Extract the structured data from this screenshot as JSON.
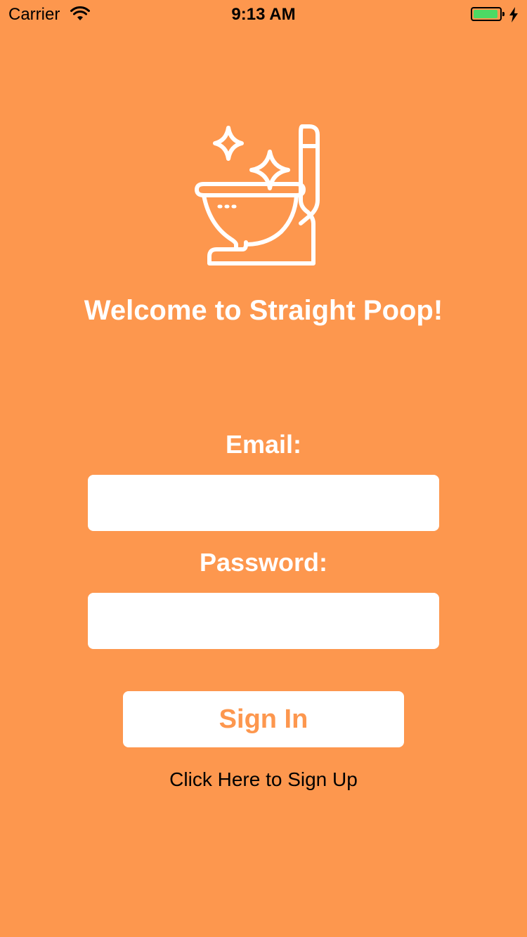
{
  "status_bar": {
    "carrier": "Carrier",
    "time": "9:13 AM",
    "battery_color": "#4CD964"
  },
  "app": {
    "background_color": "#FD974E",
    "logo_icon": "sparkling-toilet-icon",
    "welcome_title": "Welcome to Straight Poop!"
  },
  "form": {
    "email_label": "Email:",
    "email_value": "",
    "email_placeholder": "",
    "password_label": "Password:",
    "password_value": "",
    "password_placeholder": "",
    "sign_in_label": "Sign In",
    "sign_up_link": "Click Here to Sign Up"
  }
}
